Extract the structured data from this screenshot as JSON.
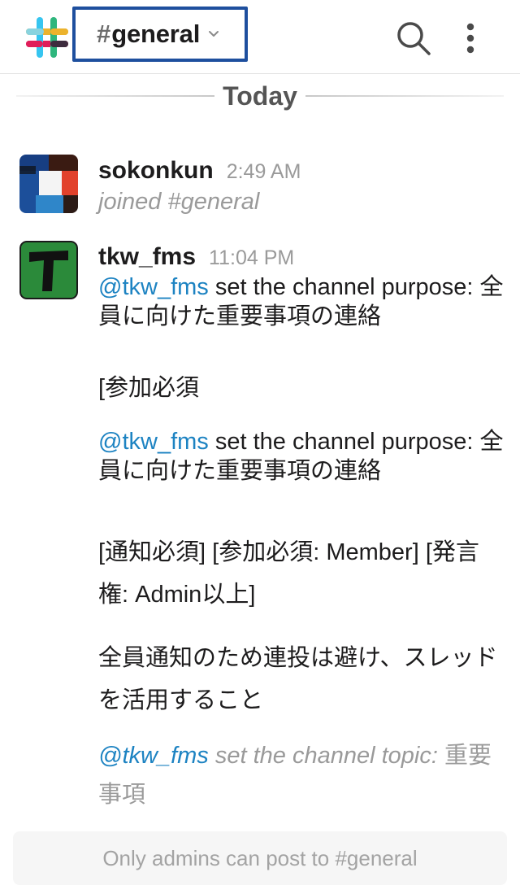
{
  "header": {
    "hash": "#",
    "channel_name": "general",
    "icons": {
      "logo": "slack-logo",
      "chevron": "chevron-down-icon",
      "search": "search-icon",
      "more": "more-vertical-icon"
    },
    "colors": {
      "selector_border": "#1e4f9e"
    }
  },
  "divider": {
    "label": "Today"
  },
  "messages": [
    {
      "username": "sokonkun",
      "time": "2:49 AM",
      "text": "joined #general"
    },
    {
      "username": "tkw_fms",
      "time": "11:04 PM",
      "mention1": "@tkw_fms",
      "purpose_text1": " set the channel purpose: 全員に向けた重要事項の連絡",
      "para_a": "[参加必須",
      "mention2": "@tkw_fms",
      "purpose_text2": " set the channel purpose: 全員に向けた重要事項の連絡",
      "para_b": "[通知必須] [参加必須: Member] [発言権: Admin以上]",
      "para_c": "全員通知のため連投は避け、スレッドを活用すること",
      "mention3": "@tkw_fms",
      "topic_text": " set the channel topic: ",
      "topic_value": "重要事項"
    }
  ],
  "footer": {
    "notice": "Only admins can post to #general"
  },
  "colors": {
    "mention": "#1d83c2",
    "muted": "#9a9a9a"
  }
}
